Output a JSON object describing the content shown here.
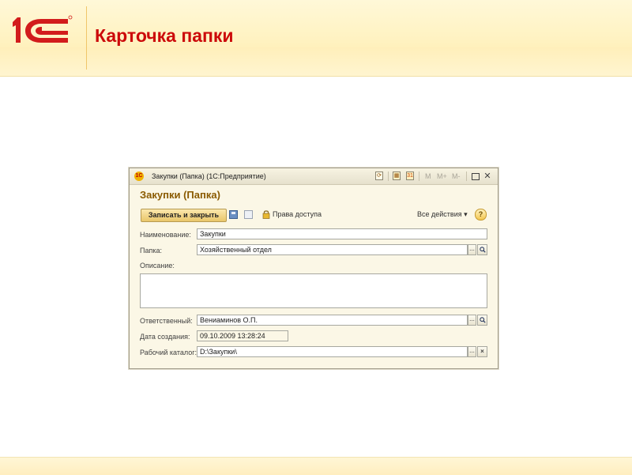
{
  "slide": {
    "title": "Карточка папки",
    "logo_text": "1С"
  },
  "window": {
    "app_icon": "1С",
    "title": "Закупки (Папка)  (1С:Предприятие)",
    "memory_buttons": [
      "M",
      "M+",
      "M-"
    ],
    "form_title": "Закупки (Папка)",
    "toolbar": {
      "save_close_label": "Записать и закрыть",
      "access_label": "Права доступа",
      "all_actions_label": "Все действия ▾",
      "help_label": "?"
    },
    "fields": {
      "name": {
        "label": "Наименование:",
        "value": "Закупки"
      },
      "folder": {
        "label": "Папка:",
        "value": "Хозяйственный отдел"
      },
      "description": {
        "label": "Описание:",
        "value": ""
      },
      "responsible": {
        "label": "Ответственный:",
        "value": "Вениаминов О.П."
      },
      "created": {
        "label": "Дата создания:",
        "value": "09.10.2009 13:28:24"
      },
      "work_dir": {
        "label": "Рабочий каталог:",
        "value": "D:\\Закупки\\"
      }
    },
    "icons": {
      "choose": "...",
      "open": "magnifier-icon",
      "clear": "×"
    },
    "colors": {
      "slide_title": "#cc0a0a",
      "form_title": "#8a5a00",
      "primary_button": "#e9c66a"
    }
  }
}
